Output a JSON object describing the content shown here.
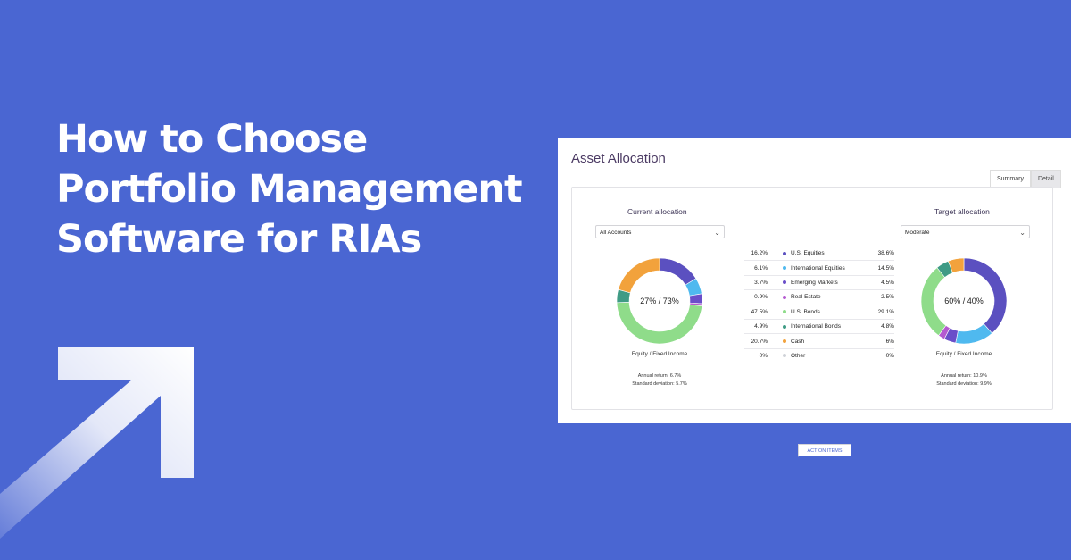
{
  "headline": {
    "lines": [
      "How to Choose",
      "Portfolio Management",
      "Software for RIAs"
    ],
    "color": "#ffffff"
  },
  "background_color": "#4a66d2",
  "arrow_icon": "arrow-up-right-icon",
  "card": {
    "title": "Asset Allocation",
    "tabs": [
      {
        "label": "Summary",
        "active": true
      },
      {
        "label": "Detail",
        "active": false
      }
    ],
    "current": {
      "heading": "Current allocation",
      "select_value": "All Accounts",
      "center_text": "27% / 73%",
      "caption": "Equity / Fixed Income",
      "annual_return": "Annual return: 6.7%",
      "std_dev": "Standard deviation: 5.7%"
    },
    "target": {
      "heading": "Target allocation",
      "select_value": "Moderate",
      "center_text": "60% / 40%",
      "caption": "Equity / Fixed Income",
      "annual_return": "Annual return: 10.9%",
      "std_dev": "Standard deviation: 9.9%"
    },
    "allocations": [
      {
        "current": "16.2%",
        "name": "U.S. Equities",
        "target": "38.6%",
        "color": "#5b50c0",
        "cur_val": 16.2,
        "tgt_val": 38.6
      },
      {
        "current": "6.1%",
        "name": "International Equities",
        "target": "14.5%",
        "color": "#4fb9ef",
        "cur_val": 6.1,
        "tgt_val": 14.5
      },
      {
        "current": "3.7%",
        "name": "Emerging Markets",
        "target": "4.5%",
        "color": "#6a4ec9",
        "cur_val": 3.7,
        "tgt_val": 4.5
      },
      {
        "current": "0.9%",
        "name": "Real Estate",
        "target": "2.5%",
        "color": "#b45ad0",
        "cur_val": 0.9,
        "tgt_val": 2.5
      },
      {
        "current": "47.5%",
        "name": "U.S. Bonds",
        "target": "29.1%",
        "color": "#8fdc8a",
        "cur_val": 47.5,
        "tgt_val": 29.1
      },
      {
        "current": "4.9%",
        "name": "International Bonds",
        "target": "4.8%",
        "color": "#3f9b85",
        "cur_val": 4.9,
        "tgt_val": 4.8
      },
      {
        "current": "20.7%",
        "name": "Cash",
        "target": "6%",
        "color": "#f2a23c",
        "cur_val": 20.7,
        "tgt_val": 6
      },
      {
        "current": "0%",
        "name": "Other",
        "target": "0%",
        "color": "#cfd2d8",
        "cur_val": 0,
        "tgt_val": 0
      }
    ],
    "action_button": "ACTION ITEMS",
    "accent_color": "#4a66d2"
  }
}
